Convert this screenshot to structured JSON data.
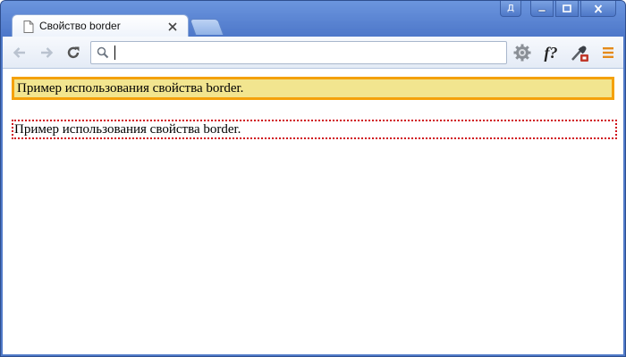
{
  "window": {
    "user_badge": "Д"
  },
  "tab": {
    "title": "Свойство border"
  },
  "omnibox": {
    "value": ""
  },
  "page": {
    "paragraph1": "Пример использования свойства border.",
    "paragraph2": "Пример использования свойства border."
  },
  "colors": {
    "titlebar": "#5682d2",
    "p1_border": "#f4a10b",
    "p1_background": "#f2e58f",
    "p2_border": "#d0101a"
  },
  "icons": {
    "tab": "page-icon",
    "close": "close-icon",
    "back": "back-arrow-icon",
    "forward": "forward-arrow-icon",
    "reload": "reload-icon",
    "search": "search-icon",
    "settings": "gear-icon",
    "formula": "formula-icon",
    "eyedropper": "eyedropper-icon",
    "menu": "menu-icon"
  }
}
